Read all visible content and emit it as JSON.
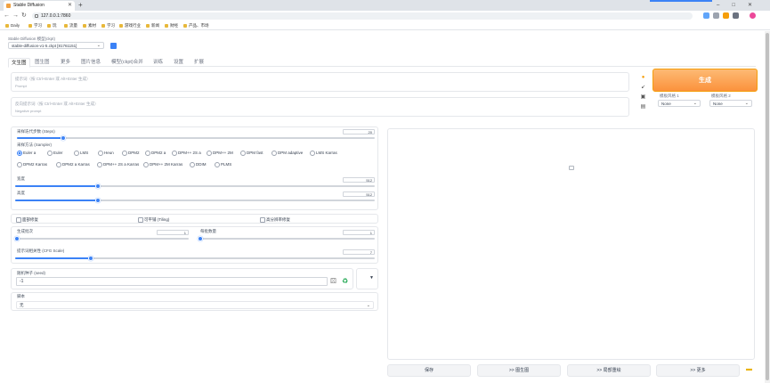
{
  "browser": {
    "tab_title": "Stable Diffusion",
    "url": "127.0.0.1:7860",
    "bookmarks": [
      "Daily",
      "学习",
      "玩",
      "流量",
      "素材",
      "学习",
      "游戏行业",
      "新闻",
      "财经",
      "产品、市场"
    ]
  },
  "model": {
    "label": "Stable Diffusion 模型(ckpt)",
    "value": "stable-diffusion-v1-5.ckpt [81761151]"
  },
  "tabs": [
    "文生图",
    "图生图",
    "更多",
    "图片信息",
    "模型(ckpt)合并",
    "训练",
    "设置",
    "扩展"
  ],
  "prompt": {
    "placeholder": "提示词（按 Ctrl+Enter 或 Alt+Enter 生成）",
    "sub": "Prompt"
  },
  "negative_prompt": {
    "placeholder": "反向提示词（按 Ctrl+Enter 或 Alt+Enter 生成）",
    "sub": "Negative prompt"
  },
  "generate_label": "生成",
  "style1": {
    "label": "模板风格 1",
    "value": "None"
  },
  "style2": {
    "label": "模板风格 2",
    "value": "None"
  },
  "steps": {
    "label": "采样迭代步数 (Steps)",
    "value": "20",
    "fraction": 0.13
  },
  "sampler": {
    "label": "采样方法 (Sampler)",
    "row1": [
      "Euler a",
      "Euler",
      "LMS",
      "Heun",
      "DPM2",
      "DPM2 a",
      "DPM++ 2S a",
      "DPM++ 2M",
      "DPM fast",
      "DPM adaptive",
      "LMS Karras"
    ],
    "row2": [
      "DPM2 Karras",
      "DPM2 a Karras",
      "DPM++ 2S a Karras",
      "DPM++ 2M Karras",
      "DDIM",
      "PLMS"
    ]
  },
  "width": {
    "label": "宽度",
    "value": "512",
    "fraction": 0.23
  },
  "height": {
    "label": "高度",
    "value": "512",
    "fraction": 0.23
  },
  "options": [
    "面部修复",
    "可平铺 (Tiling)",
    "高分辨率修复"
  ],
  "batch_count": {
    "label": "生成批次",
    "value": "1",
    "fraction": 0.0
  },
  "batch_size": {
    "label": "每批数量",
    "value": "1",
    "fraction": 0.0
  },
  "cfg": {
    "label": "提示词相关性 (CFG Scale)",
    "value": "7",
    "fraction": 0.21
  },
  "seed": {
    "label": "随机种子 (seed)",
    "value": "-1"
  },
  "script": {
    "label": "脚本",
    "value": "无"
  },
  "actions": [
    ">> 图生图",
    ">> 局部重绘",
    ">> 更多"
  ],
  "save_label": "保存"
}
